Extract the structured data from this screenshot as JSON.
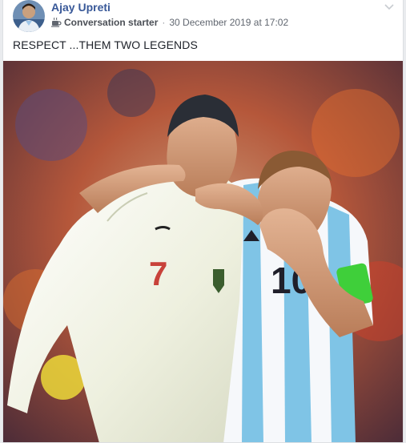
{
  "post": {
    "author": "Ajay Upreti",
    "badge_icon": "coffee-cup-icon",
    "badge_label": "Conversation starter",
    "separator": "·",
    "timestamp": "30 December 2019 at 17:02",
    "text": "RESPECT ...THEM TWO LEGENDS",
    "options_icon": "chevron-down-icon"
  },
  "colors": {
    "author_link": "#385898",
    "meta_text": "#616770",
    "body_text": "#1d2129",
    "portugal_shirt": "#f2f0e8",
    "argentina_sky_blue": "#7fc4e6",
    "captain_armband": "#3fcf3a"
  }
}
